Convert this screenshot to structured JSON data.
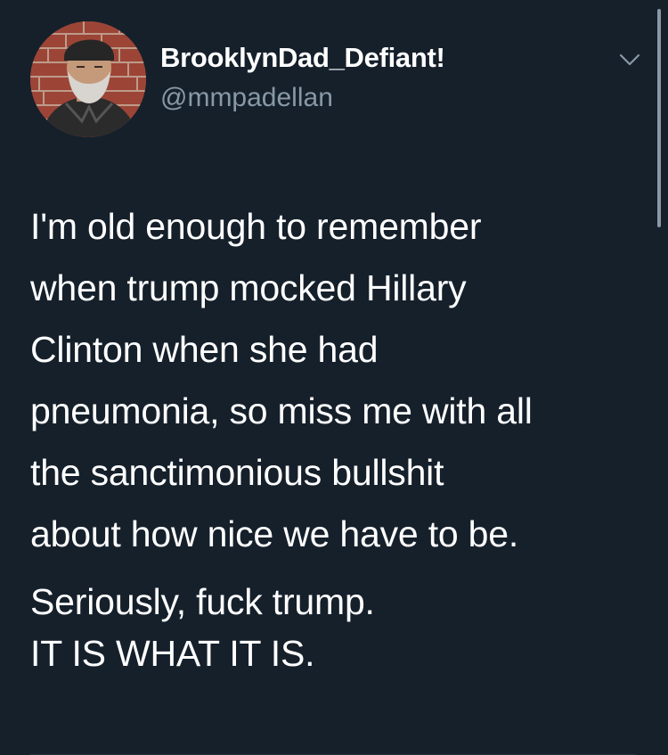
{
  "tweet": {
    "display_name": "BrooklynDad_Defiant!",
    "handle": "@mmpadellan",
    "menu_icon": "chevron-down-icon",
    "avatar_icon": "avatar-photo",
    "paragraph1": [
      "I'm old enough to remember",
      "when trump mocked Hillary",
      "Clinton when she had",
      "pneumonia, so miss me with all",
      "the sanctimonious bullshit",
      "about how nice we have to be."
    ],
    "paragraph2": [
      "Seriously, fuck trump.",
      "IT IS WHAT IT IS."
    ]
  },
  "colors": {
    "background": "#15202b",
    "text": "#ffffff",
    "secondary_text": "#8899a6"
  }
}
